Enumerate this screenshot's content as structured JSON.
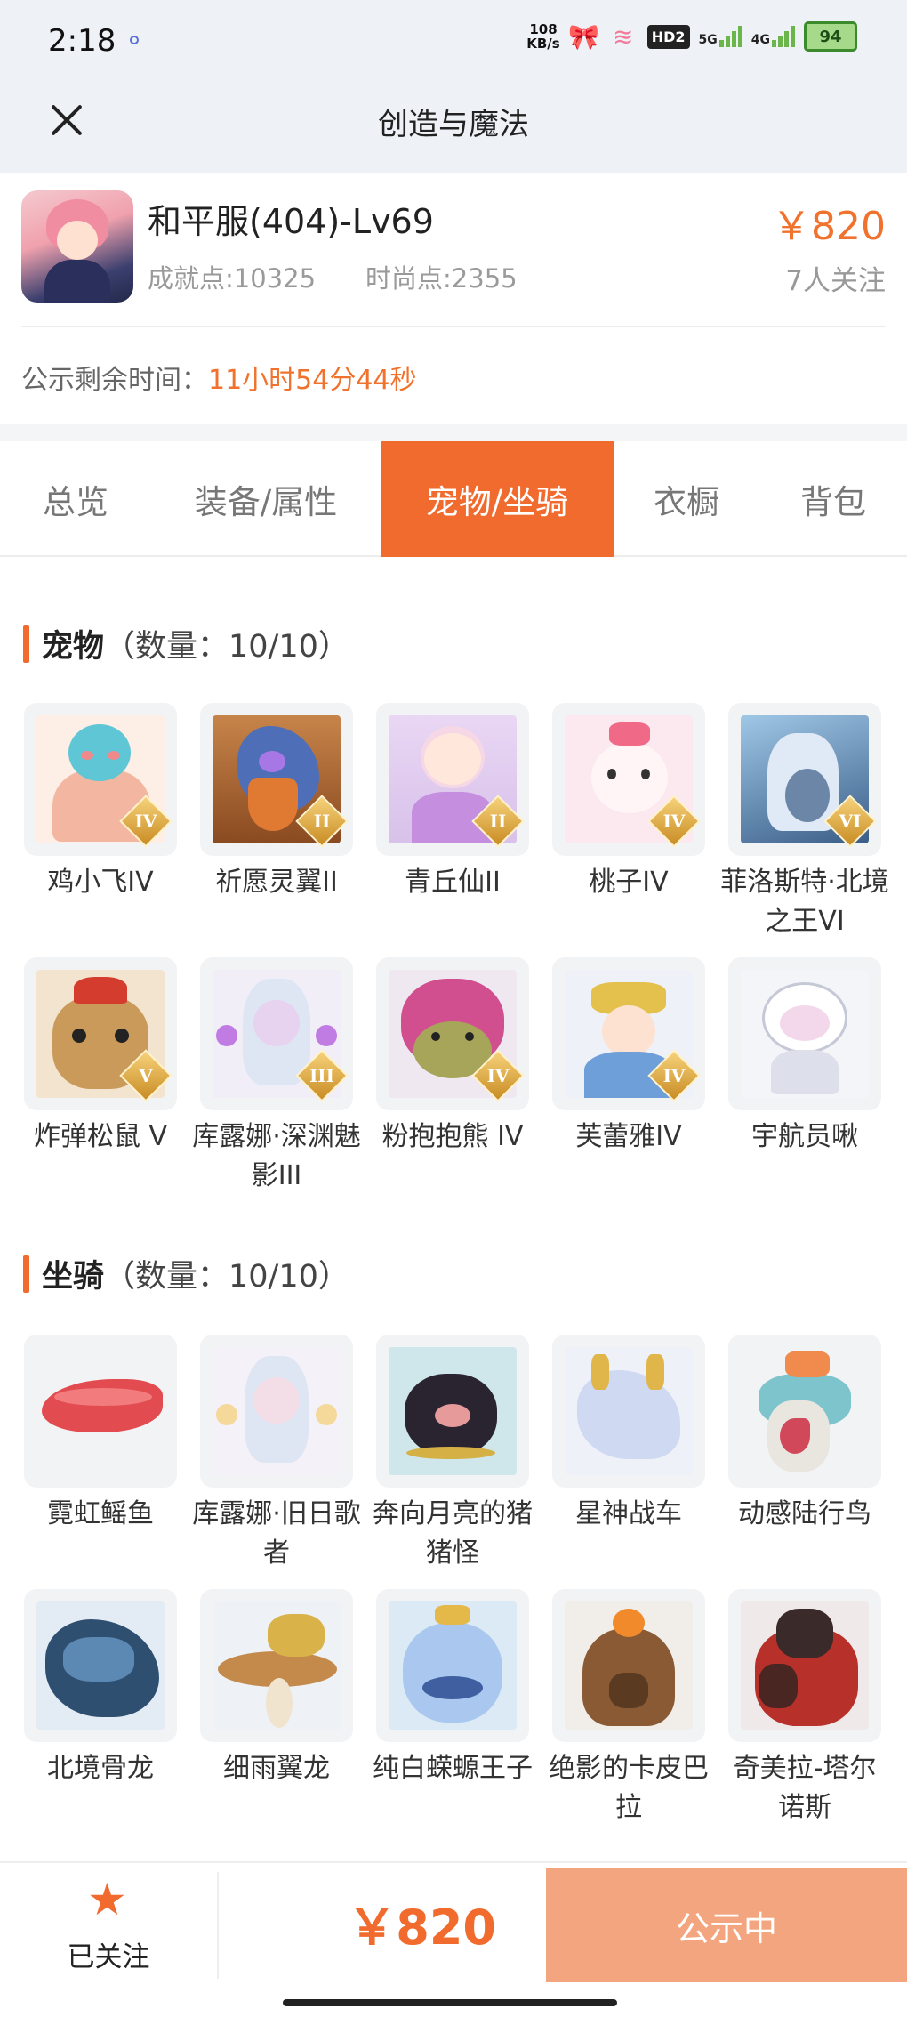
{
  "status_bar": {
    "time": "2:18",
    "net_speed_top": "108",
    "net_speed_bottom": "KB/s",
    "hd_label": "HD2",
    "sig1_label": "5G",
    "sig2_label": "4G",
    "battery": "94"
  },
  "nav": {
    "title": "创造与魔法",
    "close_icon": "close-icon"
  },
  "account": {
    "name": "和平服(404)-Lv69",
    "achievement": "成就点:10325",
    "fashion": "时尚点:2355",
    "price": "￥820",
    "followers": "7人关注",
    "countdown_label": "公示剩余时间：",
    "countdown_value": "11小时54分44秒"
  },
  "tabs": [
    {
      "label": "总览"
    },
    {
      "label": "装备/属性"
    },
    {
      "label": "宠物/坐骑"
    },
    {
      "label": "衣橱"
    },
    {
      "label": "背包"
    }
  ],
  "active_tab": "宠物/坐骑",
  "pets": {
    "title": "宠物",
    "count": "（数量：10/10）",
    "items": [
      {
        "name": "鸡小飞IV",
        "rank": "IV"
      },
      {
        "name": "祈愿灵翼II",
        "rank": "II"
      },
      {
        "name": "青丘仙II",
        "rank": "II"
      },
      {
        "name": "桃子IV",
        "rank": "IV"
      },
      {
        "name": "菲洛斯特·北境之王VI",
        "rank": "VI"
      },
      {
        "name": "炸弹松鼠 V",
        "rank": "V"
      },
      {
        "name": "库露娜·深渊魅影III",
        "rank": "III"
      },
      {
        "name": "粉抱抱熊 IV",
        "rank": "IV"
      },
      {
        "name": "芙蕾雅IV",
        "rank": "IV"
      },
      {
        "name": "宇航员啾",
        "rank": ""
      }
    ]
  },
  "mounts": {
    "title": "坐骑",
    "count": "（数量：10/10）",
    "items": [
      {
        "name": "霓虹鳐鱼"
      },
      {
        "name": "库露娜·旧日歌者"
      },
      {
        "name": "奔向月亮的猪猪怪"
      },
      {
        "name": "星神战车"
      },
      {
        "name": "动感陆行鸟"
      },
      {
        "name": "北境骨龙"
      },
      {
        "name": "细雨翼龙"
      },
      {
        "name": "纯白蝾螈王子"
      },
      {
        "name": "绝影的卡皮巴拉"
      },
      {
        "name": "奇美拉-塔尔诺斯"
      }
    ]
  },
  "bottom": {
    "follow_label": "已关注",
    "star_icon": "star-icon",
    "price": "￥820",
    "status_button": "公示中"
  },
  "colors": {
    "accent": "#f06b2d",
    "status_button": "#f3a57f"
  }
}
